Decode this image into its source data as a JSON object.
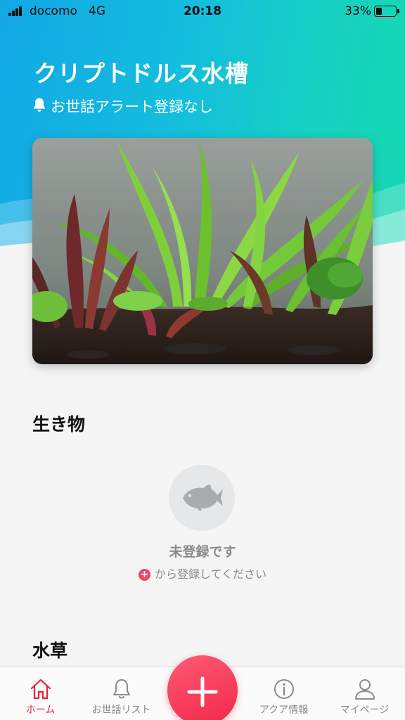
{
  "status_bar": {
    "carrier": "docomo",
    "network": "4G",
    "time": "20:18",
    "battery_text": "33%",
    "battery_level": 0.33
  },
  "tank": {
    "title": "クリプトドルス水槽",
    "alert_text": "お世話アラート登録なし"
  },
  "sections": {
    "creatures": {
      "title": "生き物",
      "empty_title": "未登録です",
      "empty_hint": "から登録してください",
      "empty_icon": "fish-icon"
    },
    "plants": {
      "title": "水草"
    }
  },
  "tabs": [
    {
      "label": "ホーム",
      "icon": "home-icon",
      "active": true
    },
    {
      "label": "お世話リスト",
      "icon": "bell-icon",
      "active": false
    },
    {
      "label": "アクア情報",
      "icon": "info-icon",
      "active": false
    },
    {
      "label": "マイページ",
      "icon": "person-icon",
      "active": false
    }
  ],
  "fab": {
    "icon": "plus-icon"
  },
  "colors": {
    "accent": "#f0284a",
    "gradient_start": "#12a7e6",
    "gradient_end": "#15d8b2",
    "muted_text": "#8a8a8a"
  }
}
